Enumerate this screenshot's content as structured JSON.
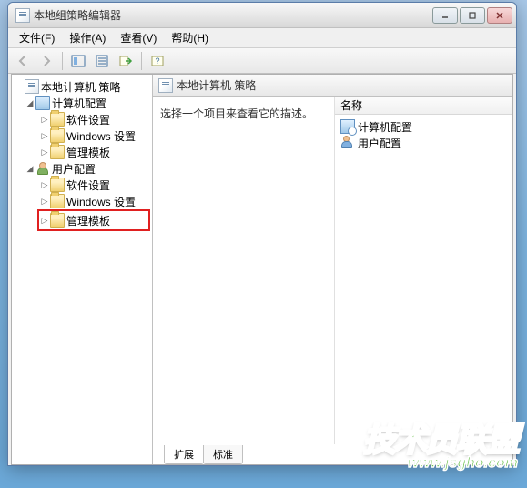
{
  "window": {
    "title": "本地组策略编辑器"
  },
  "menu": {
    "file": "文件(F)",
    "action": "操作(A)",
    "view": "查看(V)",
    "help": "帮助(H)"
  },
  "tree": {
    "root": "本地计算机 策略",
    "computer_config": "计算机配置",
    "software_settings_1": "软件设置",
    "windows_settings_1": "Windows 设置",
    "admin_templates_1": "管理模板",
    "user_config": "用户配置",
    "software_settings_2": "软件设置",
    "windows_settings_2": "Windows 设置",
    "admin_templates_2": "管理模板"
  },
  "content": {
    "header_title": "本地计算机 策略",
    "description": "选择一个项目来查看它的描述。",
    "name_header": "名称",
    "item_computer": "计算机配置",
    "item_user": "用户配置"
  },
  "tabs": {
    "extended": "扩展",
    "standard": "标准"
  },
  "watermark": {
    "brand": "技术员联盟",
    "url": "www.jsgho.com"
  }
}
